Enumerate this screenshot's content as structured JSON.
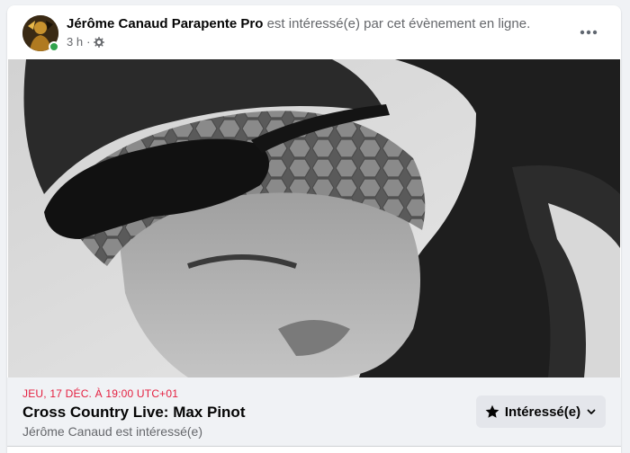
{
  "post": {
    "author": "Jérôme Canaud Parapente Pro",
    "action": "est intéressé(e) par cet évènement en ligne.",
    "time": "3 h",
    "separator": "·",
    "privacy_icon": "gear-icon",
    "more_icon": "more-horizontal-icon"
  },
  "event": {
    "date": "JEU, 17 DÉC. À 19:00 UTC+01",
    "title": "Cross Country Live: Max Pinot",
    "subtitle": "Jérôme Canaud est intéressé(e)",
    "interested_label": "Intéressé(e)",
    "interested_icon": "star-icon",
    "dropdown_icon": "chevron-down-icon"
  },
  "colors": {
    "date_red": "#e41e3f",
    "online_green": "#31a24c",
    "button_gray": "#e4e6eb"
  }
}
